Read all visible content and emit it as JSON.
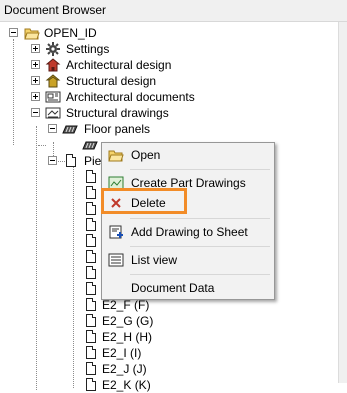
{
  "window": {
    "title": "Document Browser"
  },
  "tree": {
    "root": "OPEN_ID",
    "children": {
      "settings": "Settings",
      "arch_design": "Architectural design",
      "struct_design": "Structural design",
      "arch_docs": "Architectural documents",
      "struct_drawings": "Structural drawings",
      "floor_panels": "Floor panels",
      "pieces_partial": "Piec"
    },
    "pieces": [
      {
        "label": "E2_F  (F)"
      },
      {
        "label": "E2_G  (G)"
      },
      {
        "label": "E2_H  (H)"
      },
      {
        "label": "E2_I  (I)"
      },
      {
        "label": "E2_J  (J)"
      },
      {
        "label": "E2_K  (K)"
      }
    ]
  },
  "context_menu": {
    "open": "Open",
    "create_part_drawings": "Create Part Drawings",
    "delete": "Delete",
    "add_drawing_to_sheet": "Add Drawing to Sheet",
    "list_view": "List view",
    "document_data": "Document Data"
  },
  "colors": {
    "highlight": "#f28c28",
    "delete_icon": "#c0392b",
    "folder": "#f5d36b"
  }
}
